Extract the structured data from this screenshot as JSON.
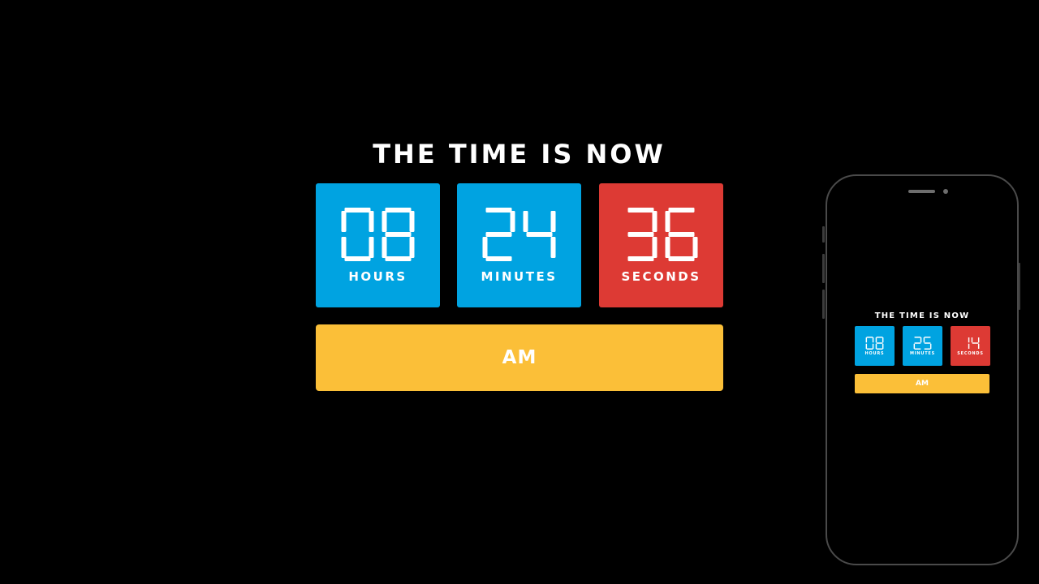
{
  "colors": {
    "background": "#000000",
    "hours_tile": "#00a3e1",
    "minutes_tile": "#00a3e1",
    "seconds_tile": "#dd3a34",
    "ampm_bar": "#fbbf38",
    "text": "#ffffff"
  },
  "clock": {
    "title": "THE TIME IS NOW",
    "hours": {
      "value": "08",
      "label": "HOURS"
    },
    "minutes": {
      "value": "24",
      "label": "MINUTES"
    },
    "seconds": {
      "value": "36",
      "label": "SECONDS"
    },
    "period": "AM"
  },
  "phone": {
    "title": "THE TIME IS NOW",
    "hours": {
      "value": "08",
      "label": "HOURS"
    },
    "minutes": {
      "value": "25",
      "label": "MINUTES"
    },
    "seconds": {
      "value": "14",
      "label": "SECONDS"
    },
    "period": "AM"
  }
}
